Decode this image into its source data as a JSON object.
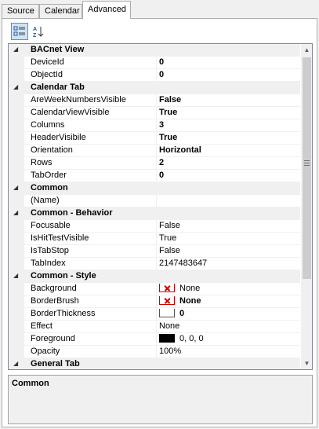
{
  "tabs": [
    "Source",
    "Calendar",
    "Advanced"
  ],
  "active_tab": "Advanced",
  "toolbar": {
    "categorized_icon": "categorized-icon",
    "alphabetical_icon": "sort-alphabetical-icon"
  },
  "grid": {
    "categories": [
      {
        "name": "BACnet View",
        "props": [
          {
            "name": "DeviceId",
            "value": "0",
            "bold": true
          },
          {
            "name": "ObjectId",
            "value": "0",
            "bold": true
          }
        ]
      },
      {
        "name": "Calendar Tab",
        "props": [
          {
            "name": "AreWeekNumbersVisible",
            "value": "False",
            "bold": true
          },
          {
            "name": "CalendarViewVisible",
            "value": "True",
            "bold": true
          },
          {
            "name": "Columns",
            "value": "3",
            "bold": true
          },
          {
            "name": "HeaderVisibile",
            "value": "True",
            "bold": true
          },
          {
            "name": "Orientation",
            "value": "Horizontal",
            "bold": true
          },
          {
            "name": "Rows",
            "value": "2",
            "bold": true
          },
          {
            "name": "TabOrder",
            "value": "0",
            "bold": true
          }
        ]
      },
      {
        "name": "Common",
        "props": [
          {
            "name": "(Name)",
            "value": "",
            "bold": false
          }
        ]
      },
      {
        "name": "Common - Behavior",
        "props": [
          {
            "name": "Focusable",
            "value": "False",
            "bold": false
          },
          {
            "name": "IsHitTestVisible",
            "value": "True",
            "bold": false
          },
          {
            "name": "IsTabStop",
            "value": "False",
            "bold": false
          },
          {
            "name": "TabIndex",
            "value": "2147483647",
            "bold": false
          }
        ]
      },
      {
        "name": "Common - Style",
        "props": [
          {
            "name": "Background",
            "value": "None",
            "bold": false,
            "swatch": "x"
          },
          {
            "name": "BorderBrush",
            "value": "None",
            "bold": true,
            "swatch": "x"
          },
          {
            "name": "BorderThickness",
            "value": "0",
            "bold": true,
            "swatch": "empty"
          },
          {
            "name": "Effect",
            "value": "None",
            "bold": false
          },
          {
            "name": "Foreground",
            "value": "0, 0, 0",
            "bold": false,
            "swatch": "black"
          },
          {
            "name": "Opacity",
            "value": "100%",
            "bold": false
          }
        ]
      },
      {
        "name": "General Tab",
        "props": []
      }
    ]
  },
  "description": {
    "title": "Common"
  }
}
